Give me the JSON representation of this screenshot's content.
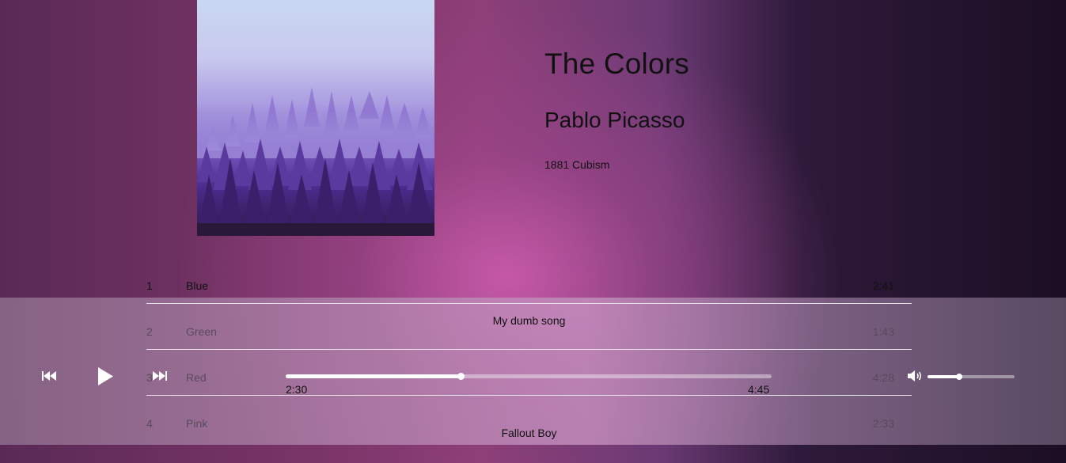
{
  "album": {
    "title": "The Colors",
    "artist": "Pablo Picasso",
    "meta": "1881 Cubism",
    "cover_icon": "forest-cover-art"
  },
  "tracks": [
    {
      "num": "1",
      "name": "Blue",
      "duration": "2:41"
    },
    {
      "num": "2",
      "name": "Green",
      "duration": "1:43"
    },
    {
      "num": "3",
      "name": "Red",
      "duration": "4:28"
    },
    {
      "num": "4",
      "name": "Pink",
      "duration": "2:33"
    }
  ],
  "player": {
    "song_title": "My dumb song",
    "song_artist": "Fallout Boy",
    "current_time": "2:30",
    "total_time": "4:45",
    "progress_fraction": 0.36,
    "volume_fraction": 0.36,
    "icons": {
      "previous": "skip-back-icon",
      "play": "play-icon",
      "next": "skip-forward-icon",
      "volume": "volume-icon"
    }
  }
}
